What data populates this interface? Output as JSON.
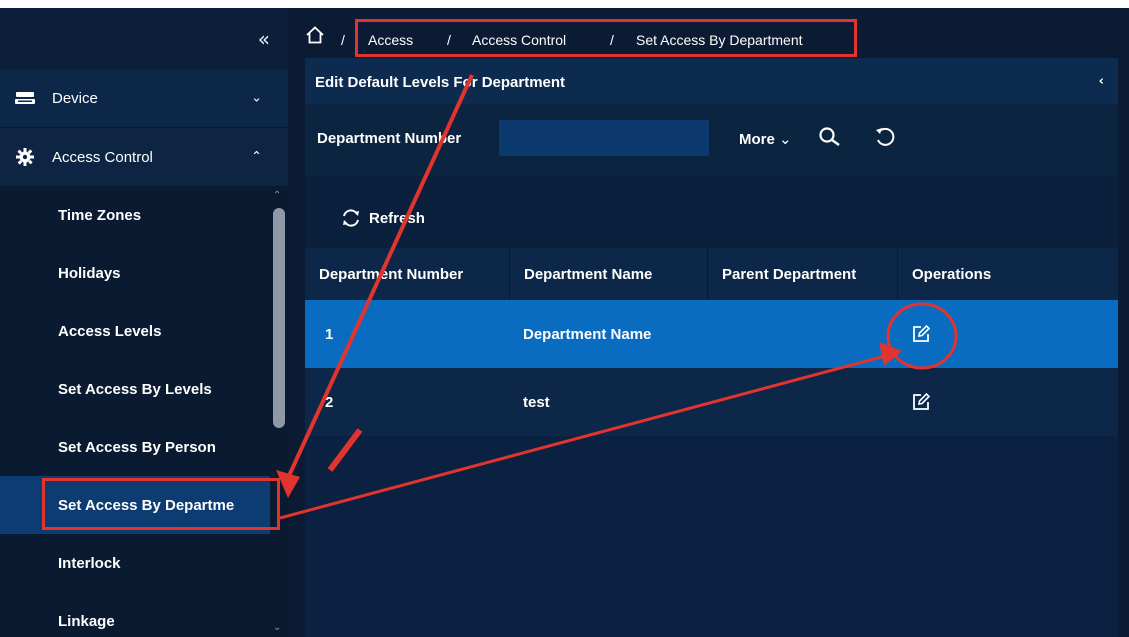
{
  "sidebar": {
    "collapse_label": "«",
    "menu": [
      {
        "label": "Device",
        "icon": "device-icon",
        "chevron": "v"
      },
      {
        "label": "Access Control",
        "icon": "gear-icon",
        "chevron": "^"
      }
    ],
    "submenu": [
      {
        "label": "Time Zones"
      },
      {
        "label": "Holidays"
      },
      {
        "label": "Access Levels"
      },
      {
        "label": "Set Access By Levels"
      },
      {
        "label": "Set Access By Person"
      },
      {
        "label": "Set Access By Departme",
        "active": true
      },
      {
        "label": "Interlock"
      },
      {
        "label": "Linkage"
      }
    ]
  },
  "breadcrumb": {
    "home_sep": "/",
    "items": [
      "Access",
      "Access Control",
      "Set Access By Department"
    ],
    "sep": "/"
  },
  "panel": {
    "title": "Edit Default Levels For Department",
    "collapse": "‹"
  },
  "search": {
    "dept_label": "Department Number",
    "dept_value": "",
    "more_label": "More"
  },
  "toolbar": {
    "refresh_label": "Refresh"
  },
  "table": {
    "columns": [
      "Department Number",
      "Department Name",
      "Parent Department",
      "Operations"
    ],
    "rows": [
      {
        "number": "1",
        "name": "Department Name",
        "parent": "",
        "selected": true
      },
      {
        "number": "2",
        "name": "test",
        "parent": "",
        "selected": false
      }
    ]
  },
  "colors": {
    "accent": "#0a6cc0",
    "annotation": "#e2342f"
  }
}
